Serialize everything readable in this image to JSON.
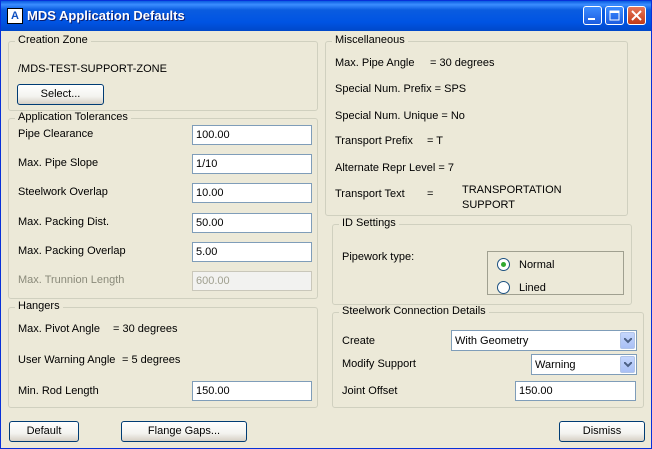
{
  "window": {
    "title": "MDS Application Defaults",
    "app_icon_glyph": "A"
  },
  "creation_zone": {
    "legend": "Creation Zone",
    "zone_name": "/MDS-TEST-SUPPORT-ZONE",
    "select_label": "Select..."
  },
  "tolerances": {
    "legend": "Application Tolerances",
    "pipe_clearance": {
      "label": "Pipe Clearance",
      "value": "100.00"
    },
    "max_pipe_slope": {
      "label": "Max. Pipe Slope",
      "value": "1/10"
    },
    "steelwork_overlap": {
      "label": "Steelwork Overlap",
      "value": "10.00"
    },
    "max_packing_dist": {
      "label": "Max. Packing Dist.",
      "value": "50.00"
    },
    "max_packing_overlap": {
      "label": "Max. Packing Overlap",
      "value": "5.00"
    },
    "max_trunnion_length": {
      "label": "Max. Trunnion Length",
      "value": "600.00"
    }
  },
  "hangers": {
    "legend": "Hangers",
    "max_pivot_angle": "Max. Pivot Angle",
    "max_pivot_angle_value": "= 30 degrees",
    "user_warning_angle": "User Warning Angle",
    "user_warning_angle_value": "= 5 degrees",
    "min_rod_length": {
      "label": "Min. Rod Length",
      "value": "150.00"
    }
  },
  "misc": {
    "legend": "Miscellaneous",
    "max_pipe_angle": "Max. Pipe Angle",
    "max_pipe_angle_value": "= 30 degrees",
    "special_num_prefix": "Special Num. Prefix = SPS",
    "special_num_unique": "Special Num. Unique = No",
    "transport_prefix": "Transport Prefix",
    "transport_prefix_value": "= T",
    "alternate_repr_level": "Alternate Repr Level = 7",
    "transport_text": "Transport Text",
    "transport_text_eq": "=",
    "transport_text_value_1": "TRANSPORTATION",
    "transport_text_value_2": "SUPPORT"
  },
  "id_settings": {
    "legend": "ID Settings",
    "pipework_type_label": "Pipework type:",
    "options": [
      "Normal",
      "Lined"
    ],
    "selected": "Normal"
  },
  "steelwork": {
    "legend": "Steelwork Connection Details",
    "create_label": "Create",
    "create_value": "With Geometry",
    "modify_support_label": "Modify Support",
    "modify_support_value": "Warning",
    "joint_offset_label": "Joint Offset",
    "joint_offset_value": "150.00"
  },
  "footer": {
    "default_label": "Default",
    "flange_gaps_label": "Flange Gaps...",
    "dismiss_label": "Dismiss"
  }
}
